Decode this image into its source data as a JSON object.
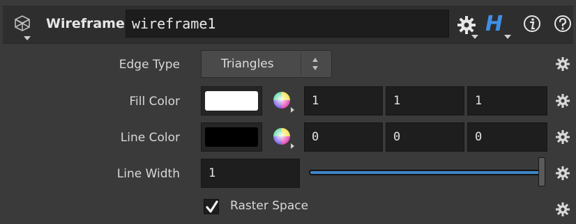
{
  "header": {
    "node_type": "Wireframe",
    "node_name": "wireframe1",
    "help_label": "H",
    "node_icon": "cube-icon",
    "gear_icon": "gear-icon",
    "info_icon": "info-icon",
    "help_icon": "question-icon"
  },
  "params": {
    "edge_type": {
      "label": "Edge Type",
      "value": "Triangles"
    },
    "fill_color": {
      "label": "Fill Color",
      "swatch": "#ffffff",
      "r": "1",
      "g": "1",
      "b": "1"
    },
    "line_color": {
      "label": "Line Color",
      "swatch": "#000000",
      "r": "0",
      "g": "0",
      "b": "0"
    },
    "line_width": {
      "label": "Line Width",
      "value": "1",
      "slider_fraction": 1.0
    },
    "raster_space": {
      "label": "Raster Space",
      "checked": true
    }
  },
  "colors": {
    "accent_blue": "#3f8fe6",
    "slider_blue": "#3e86c8",
    "panel_bg": "#3a3a3a",
    "field_bg": "#1e1e1e"
  }
}
